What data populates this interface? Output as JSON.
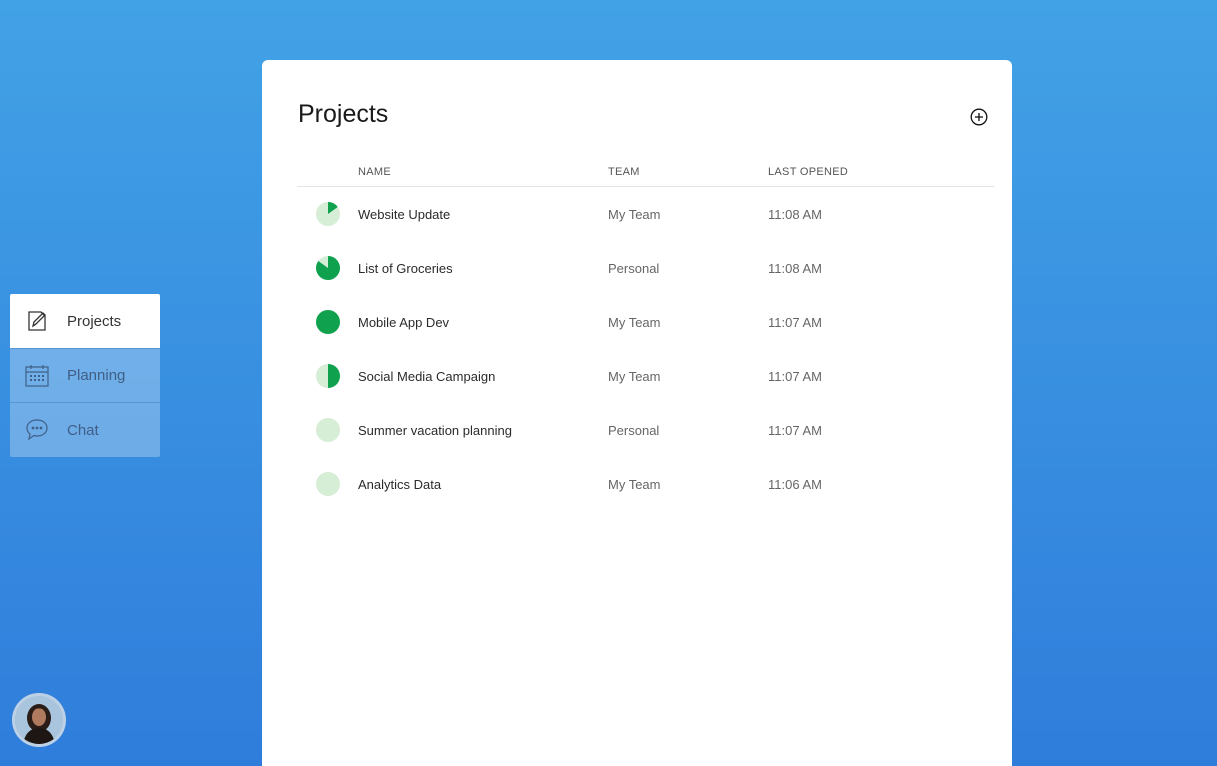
{
  "nav": {
    "items": [
      {
        "label": "Projects",
        "icon": "edit-note-icon",
        "active": true
      },
      {
        "label": "Planning",
        "icon": "calendar-icon",
        "active": false
      },
      {
        "label": "Chat",
        "icon": "chat-bubble-icon",
        "active": false
      }
    ]
  },
  "avatar": {
    "icon": "user-avatar"
  },
  "projects": {
    "title": "Projects",
    "add_icon": "add-circle-icon",
    "columns": {
      "name": "NAME",
      "team": "TEAM",
      "last_opened": "LAST OPENED"
    },
    "rows": [
      {
        "name": "Website Update",
        "team": "My Team",
        "last_opened": "11:08 AM",
        "progress": 0.15
      },
      {
        "name": "List of Groceries",
        "team": "Personal",
        "last_opened": "11:08 AM",
        "progress": 0.85
      },
      {
        "name": "Mobile App Dev",
        "team": "My Team",
        "last_opened": "11:07 AM",
        "progress": 1.0
      },
      {
        "name": "Social Media Campaign",
        "team": "My Team",
        "last_opened": "11:07 AM",
        "progress": 0.5
      },
      {
        "name": "Summer vacation planning",
        "team": "Personal",
        "last_opened": "11:07 AM",
        "progress": 0.0
      },
      {
        "name": "Analytics Data",
        "team": "My Team",
        "last_opened": "11:06 AM",
        "progress": 0.0
      }
    ]
  },
  "colors": {
    "progress_fill": "#0fa14e",
    "progress_track": "#d6edd6",
    "background_top": "#42a2e6",
    "background_bottom": "#2f7ddb"
  }
}
